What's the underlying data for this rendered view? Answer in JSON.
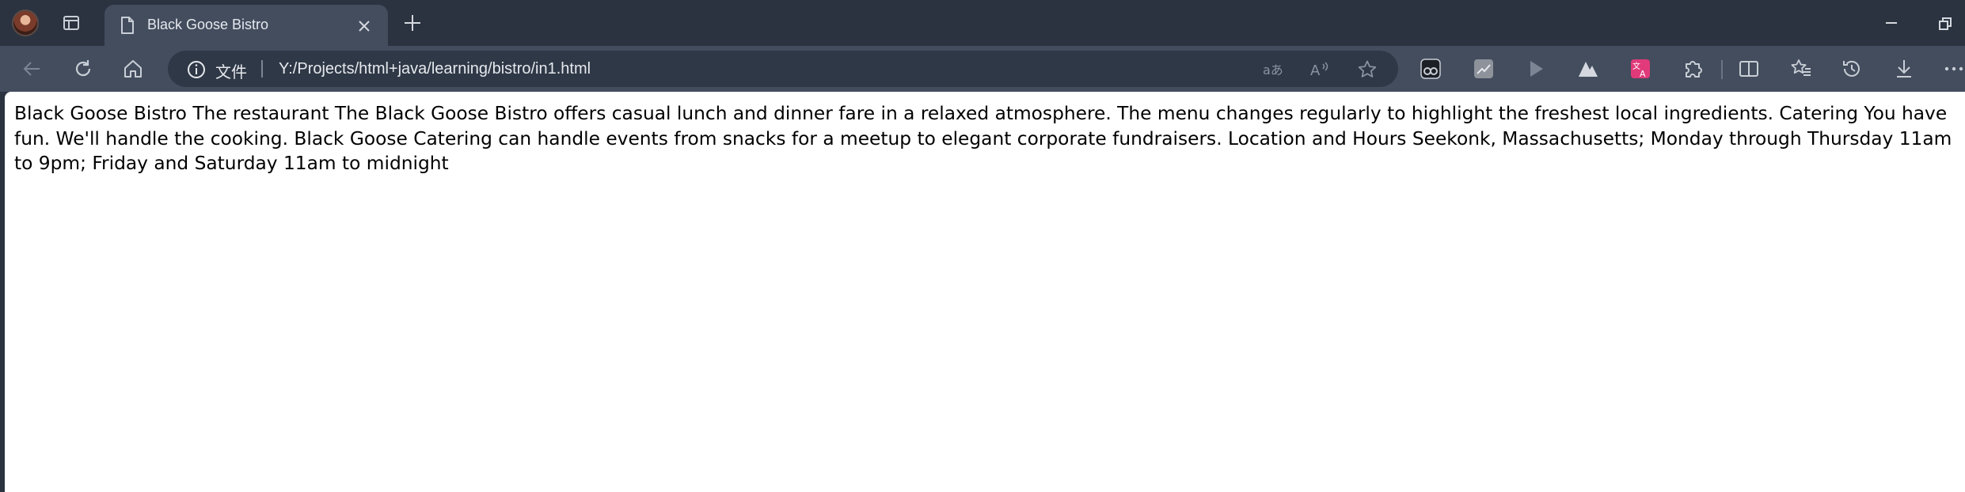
{
  "window": {
    "tab": {
      "title": "Black Goose Bistro"
    },
    "controls": [
      "minimize",
      "restore"
    ]
  },
  "toolbar": {
    "address": {
      "scheme_label": "文件",
      "url": "Y:/Projects/html+java/learning/bistro/in1.html"
    }
  },
  "page": {
    "body_text": "Black Goose Bistro The restaurant The Black Goose Bistro offers casual lunch and dinner fare in a relaxed atmosphere. The menu changes regularly to highlight the freshest local ingredients. Catering You have fun. We'll handle the cooking. Black Goose Catering can handle events from snacks for a meetup to elegant corporate fundraisers. Location and Hours Seekonk, Massachusetts; Monday through Thursday 11am to 9pm; Friday and Saturday 11am to midnight"
  },
  "colors": {
    "frame": "#2b3340",
    "toolbar": "#434d5e",
    "omnibox": "#2f3846",
    "icon": "#c9ced6",
    "page_bg": "#ffffff",
    "ext_pink": "#e03a7a"
  }
}
